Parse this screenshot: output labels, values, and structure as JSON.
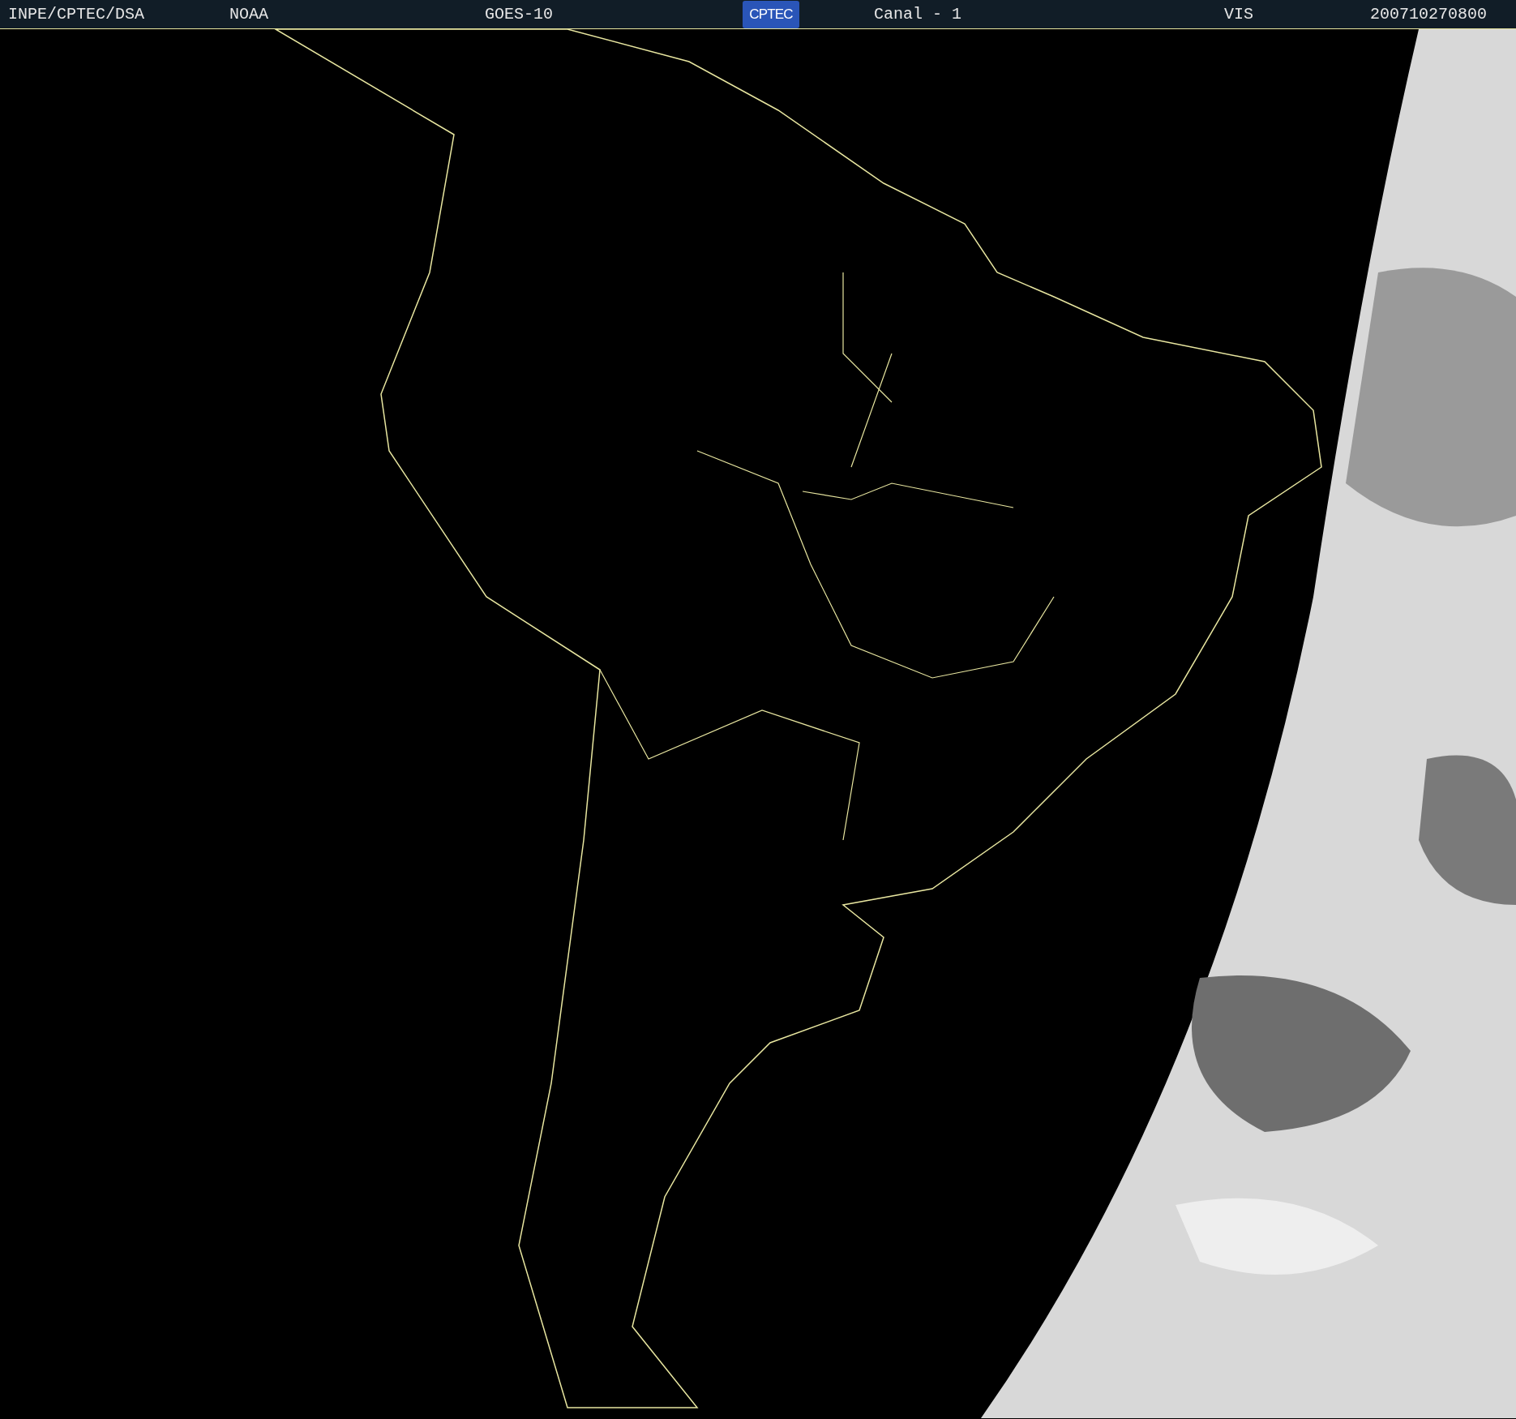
{
  "header": {
    "items": [
      {
        "kind": "text",
        "text": "INPE/CPTEC/DSA"
      },
      {
        "kind": "text",
        "text": "NOAA"
      },
      {
        "kind": "text",
        "text": "GOES-10"
      },
      {
        "kind": "logo",
        "text": "CPTEC"
      },
      {
        "kind": "text",
        "text": "Canal - 1"
      },
      {
        "kind": "text",
        "text": "VIS"
      },
      {
        "kind": "text",
        "text": "200710270800"
      }
    ]
  }
}
